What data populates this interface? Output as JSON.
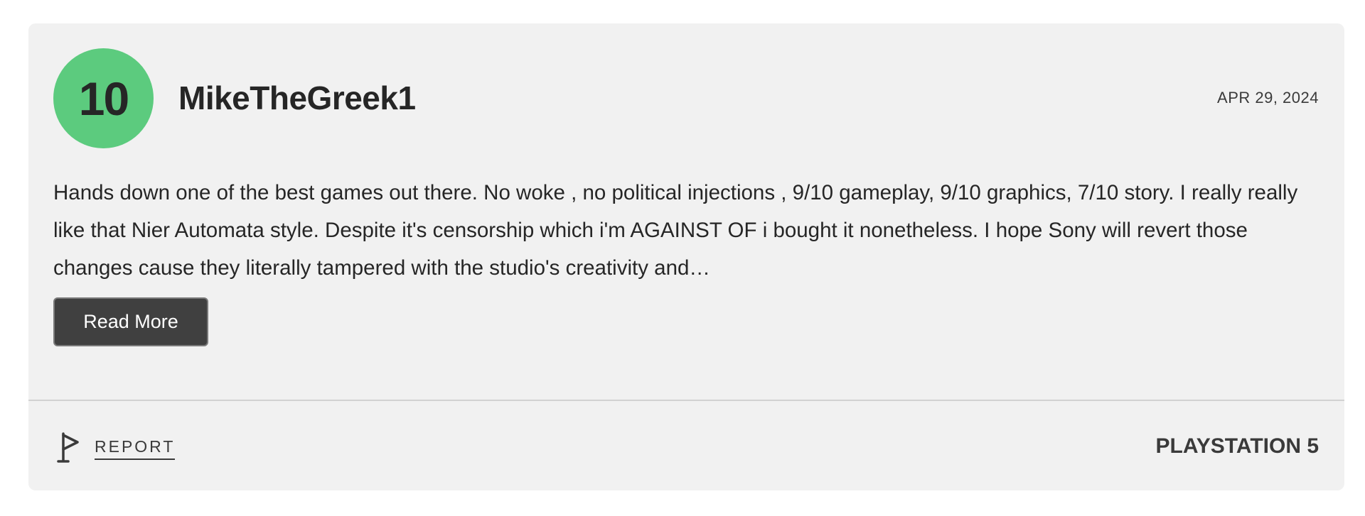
{
  "review": {
    "score": "10",
    "score_color": "#5ccb7e",
    "username": "MikeTheGreek1",
    "date": "APR 29, 2024",
    "text": "Hands down one of the best games out there. No woke , no political injections , 9/10 gameplay, 9/10 graphics, 7/10 story. I really really like that Nier Automata style. Despite it's censorship which i'm AGAINST OF i bought it nonetheless. I hope Sony will revert those changes cause they literally tampered with the studio's creativity and…",
    "read_more_label": "Read More",
    "report_label": "REPORT",
    "report_icon": "flag-icon",
    "platform": "PLAYSTATION 5"
  }
}
